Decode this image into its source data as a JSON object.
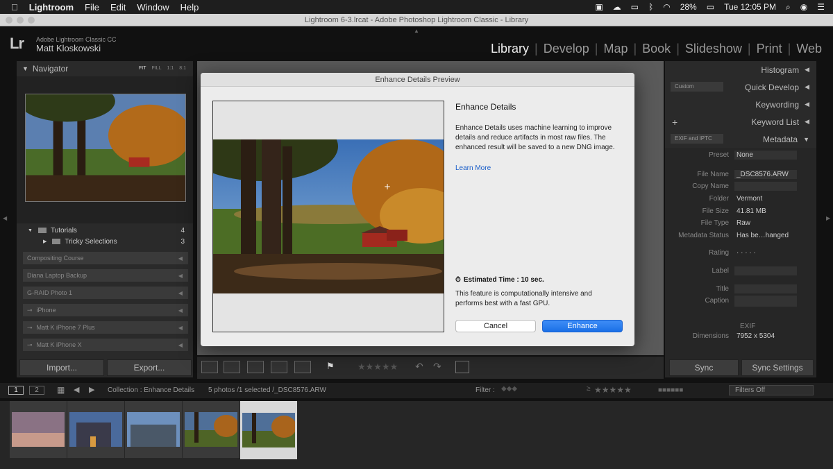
{
  "menubar": {
    "app": "Lightroom",
    "items": [
      "File",
      "Edit",
      "Window",
      "Help"
    ],
    "battery": "28%",
    "clock": "Tue 12:05 PM"
  },
  "window": {
    "title": "Lightroom 6-3.lrcat - Adobe Photoshop Lightroom Classic - Library"
  },
  "header": {
    "logo": "Lr",
    "app_name": "Adobe Lightroom Classic CC",
    "user": "Matt Kloskowski",
    "modules": [
      "Library",
      "Develop",
      "Map",
      "Book",
      "Slideshow",
      "Print",
      "Web"
    ],
    "active_module": "Library"
  },
  "navigator": {
    "title": "Navigator",
    "zoom": [
      "FIT",
      "FILL",
      "1:1",
      "8:1"
    ]
  },
  "folders": {
    "tutorials": {
      "label": "Tutorials",
      "count": "4"
    },
    "tricky": {
      "label": "Tricky Selections",
      "count": "3"
    },
    "volumes": [
      "Compositing Course",
      "Diana Laptop Backup",
      "G-RAID Photo 1",
      "iPhone",
      "Matt K iPhone 7 Plus",
      "Matt K iPhone X"
    ]
  },
  "left_buttons": {
    "import": "Import...",
    "export": "Export..."
  },
  "right_panel": {
    "histogram": "Histogram",
    "quick_develop": "Quick Develop",
    "custom": "Custom",
    "keywording": "Keywording",
    "keyword_list": "Keyword List",
    "plus": "+",
    "metadata": "Metadata",
    "exif": "EXIF and IPTC",
    "preset_label": "Preset",
    "preset_value": "None",
    "fields": [
      {
        "k": "File Name",
        "v": "_DSC8576.ARW"
      },
      {
        "k": "Copy Name",
        "v": ""
      },
      {
        "k": "Folder",
        "v": "Vermont"
      },
      {
        "k": "File Size",
        "v": "41.81 MB"
      },
      {
        "k": "File Type",
        "v": "Raw"
      },
      {
        "k": "Metadata Status",
        "v": "Has be…hanged"
      }
    ],
    "rating_label": "Rating",
    "rating_value": "· · · · ·",
    "label_label": "Label",
    "title_label": "Title",
    "caption_label": "Caption",
    "exif_section": "EXIF",
    "dimensions_label": "Dimensions",
    "dimensions_value": "7952 x 5304",
    "sync": "Sync",
    "sync_settings": "Sync Settings"
  },
  "filmbar": {
    "page1": "1",
    "page2": "2",
    "collection": "Collection : Enhance Details",
    "selection": "5 photos /1 selected /_DSC8576.ARW",
    "filter_label": "Filter :",
    "filters_off": "Filters Off",
    "stars_prefix": "≥",
    "stars": "★★★★★"
  },
  "dialog": {
    "title": "Enhance Details Preview",
    "heading": "Enhance Details",
    "description": "Enhance Details uses machine learning to improve details and reduce artifacts in most raw files. The enhanced result will be saved to a new DNG image.",
    "learn_more": "Learn More",
    "estimated": "Estimated Time : 10 sec.",
    "gpu_note": "This feature is computationally intensive and performs best with a fast GPU.",
    "cancel": "Cancel",
    "enhance": "Enhance"
  },
  "colors": {
    "accent": "#1a6fe6",
    "panel": "#2a2a2a",
    "link": "#1a5ec9"
  }
}
